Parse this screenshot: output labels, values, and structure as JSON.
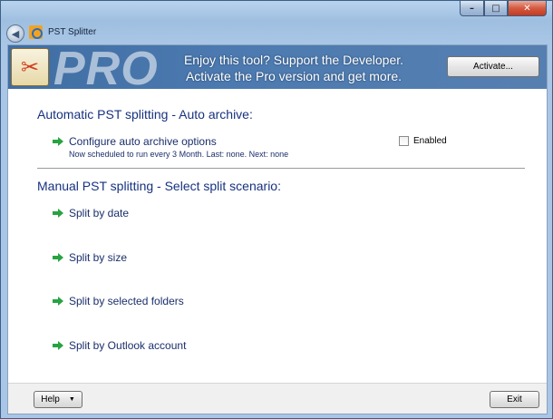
{
  "window": {
    "title": "PST Splitter",
    "controls": {
      "minimize": "–",
      "maximize": "□",
      "close": "✕"
    }
  },
  "banner": {
    "logo_text": "PRO",
    "message_line1": "Enjoy this tool? Support the Developer.",
    "message_line2": "Activate the Pro version and get more.",
    "activate_button": "Activate..."
  },
  "auto_section": {
    "title": "Automatic PST splitting - Auto archive:",
    "action_label": "Configure auto archive options",
    "schedule_text": "Now scheduled to run every 3 Month. Last: none. Next: none",
    "enabled_label": "Enabled",
    "enabled_checked": false
  },
  "manual_section": {
    "title": "Manual PST splitting - Select split scenario:",
    "actions": [
      {
        "label": "Split by date"
      },
      {
        "label": "Split by size"
      },
      {
        "label": "Split by selected folders"
      },
      {
        "label": "Split by Outlook account"
      }
    ]
  },
  "footer": {
    "help_button": "Help",
    "exit_button": "Exit"
  },
  "icons": {
    "back": "back-arrow-icon",
    "app": "app-icon",
    "action_arrow": "green-arrow-icon"
  },
  "colors": {
    "heading": "#17327f",
    "arrow": "#27a342",
    "banner": "#4c7ab0"
  }
}
